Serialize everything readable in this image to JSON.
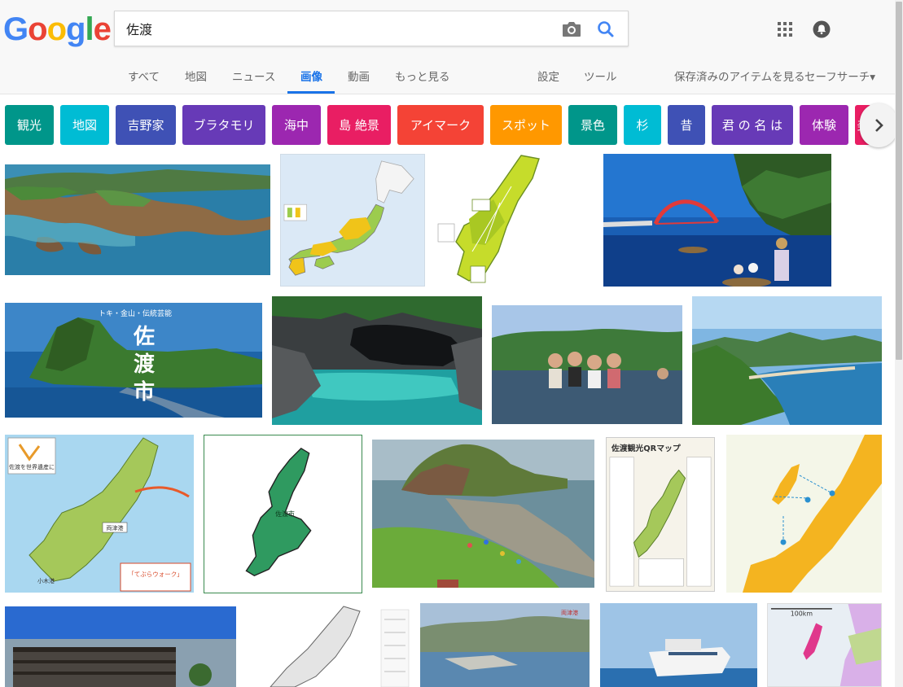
{
  "logo": {
    "text": "Google",
    "letters": [
      {
        "ch": "G",
        "color": "#4285f4"
      },
      {
        "ch": "o",
        "color": "#ea4335"
      },
      {
        "ch": "o",
        "color": "#fbbc05"
      },
      {
        "ch": "g",
        "color": "#4285f4"
      },
      {
        "ch": "l",
        "color": "#34a853"
      },
      {
        "ch": "e",
        "color": "#ea4335"
      }
    ]
  },
  "search": {
    "query": "佐渡"
  },
  "icons": {
    "camera": "camera-icon",
    "search": "search-icon",
    "apps": "apps-grid-icon",
    "notifications": "bell-icon",
    "next": "chevron-right-icon"
  },
  "tabs": {
    "all": "すべて",
    "maps": "地図",
    "news": "ニュース",
    "images": "画像",
    "videos": "動画",
    "more": "もっと見る",
    "settings": "設定",
    "tools": "ツール",
    "saved": "保存済みのアイテムを見る",
    "safesearch": "セーフサーチ▾"
  },
  "chips": [
    {
      "label": "観光",
      "color": "#00968a"
    },
    {
      "label": "地図",
      "color": "#00bcd4"
    },
    {
      "label": "吉野家",
      "color": "#3f51b5"
    },
    {
      "label": "ブラタモリ",
      "color": "#673ab7"
    },
    {
      "label": "海中",
      "color": "#9c27b0"
    },
    {
      "label": "島 絶景",
      "color": "#e91e63"
    },
    {
      "label": "アイマーク",
      "color": "#f44336"
    },
    {
      "label": "スポット",
      "color": "#ff9800"
    },
    {
      "label": "景色",
      "color": "#00968a"
    },
    {
      "label": "杉",
      "color": "#00bcd4"
    },
    {
      "label": "昔",
      "color": "#3f51b5"
    },
    {
      "label": "君 の 名 は",
      "color": "#673ab7"
    },
    {
      "label": "体験",
      "color": "#9c27b0"
    },
    {
      "label": "美",
      "color": "#e91e63"
    }
  ],
  "thumb_text": {
    "sado_city_title": "佐渡市",
    "sado_city_sub": "トキ・金山・伝統芸能",
    "city_label": "佐渡市",
    "qr_title": "佐渡観光QRマップ",
    "scale_label": "100km",
    "port_label": "両津港",
    "ogi_port": "小木港",
    "tourism_banner": "「てぶらウォーク」",
    "heritage_label": "佐渡を世界遺産に"
  },
  "colors": {
    "accent": "#1a73e8",
    "tab_text": "#666666"
  }
}
